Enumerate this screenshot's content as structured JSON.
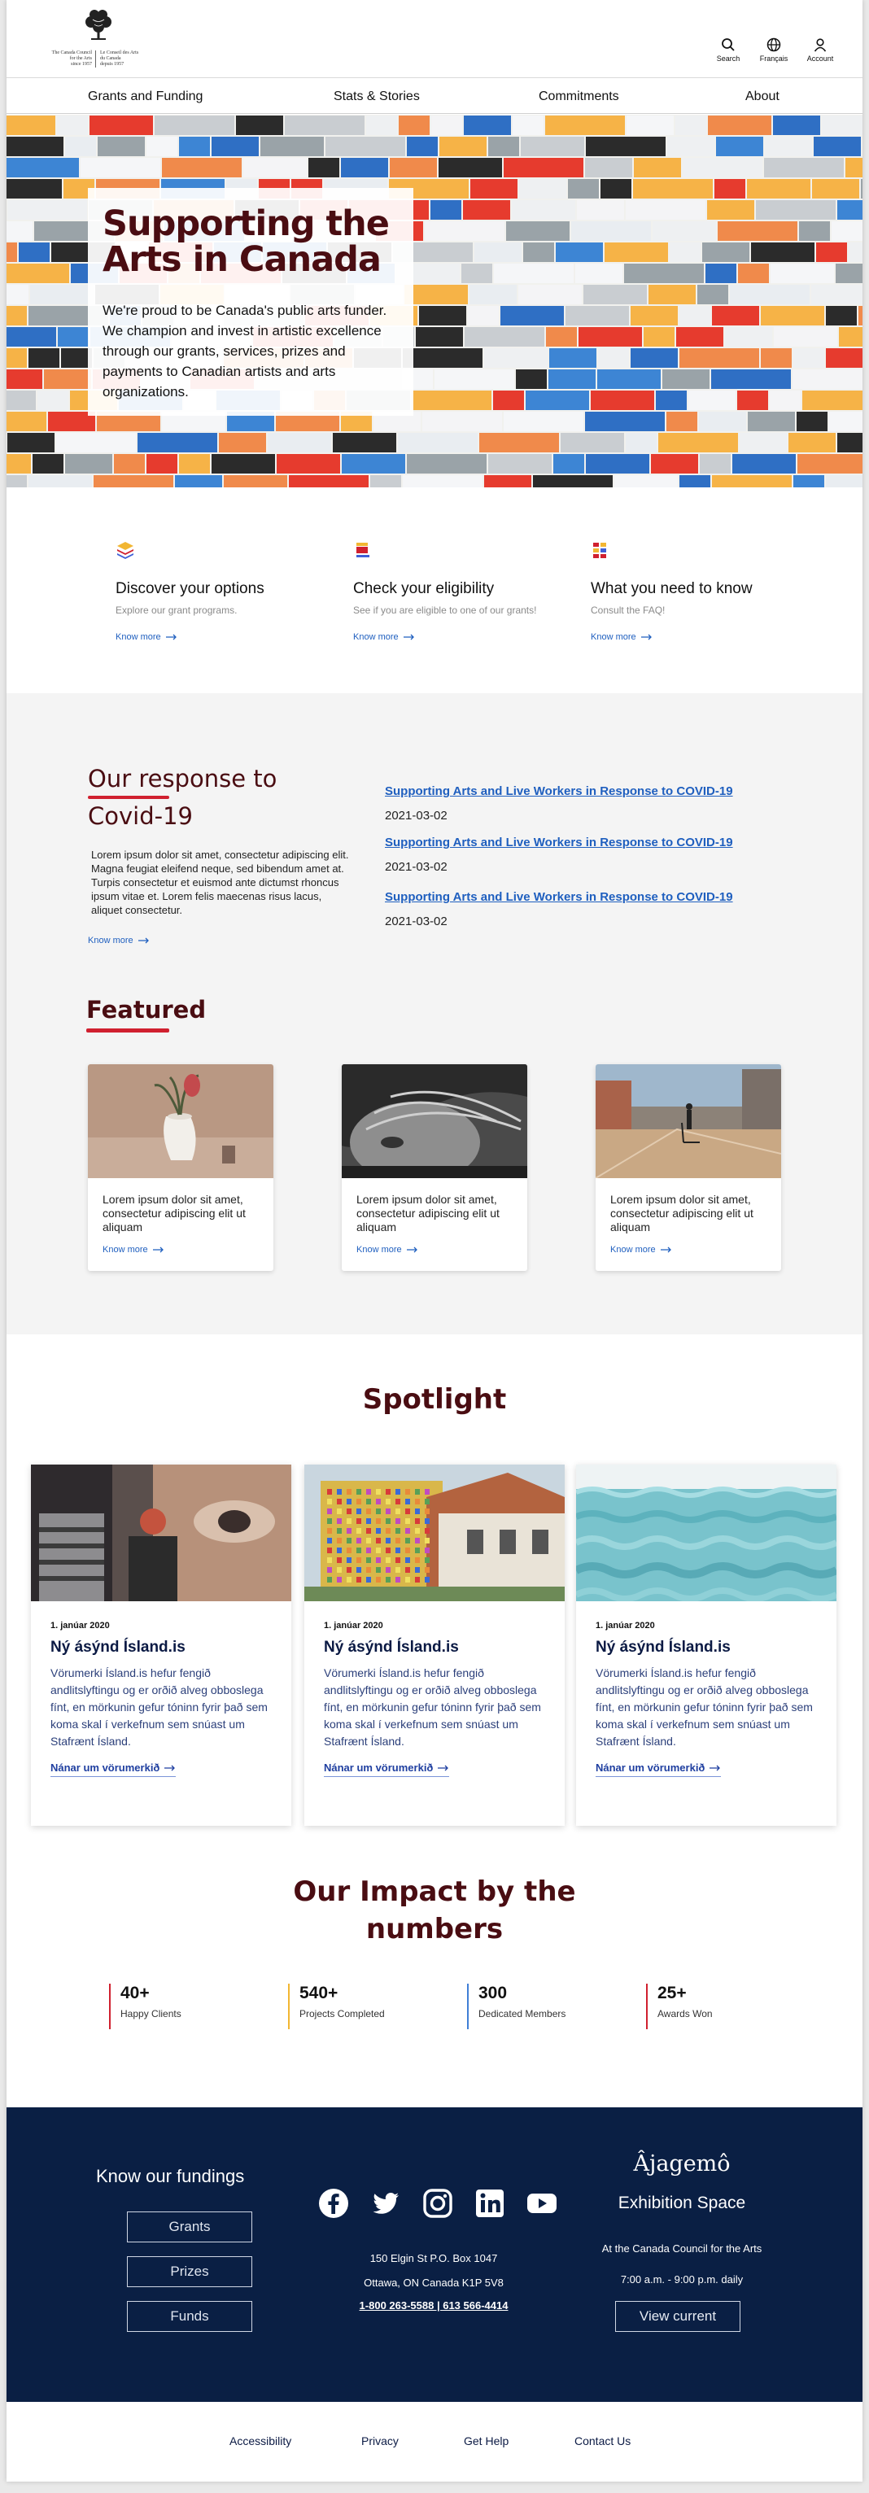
{
  "logo": {
    "en_lines": [
      "The Canada Council",
      "for the Arts",
      "since 1957"
    ],
    "fr_lines": [
      "Le Conseil des Arts",
      "du Canada",
      "depuis 1957"
    ]
  },
  "header_tools": [
    {
      "label": "Search",
      "icon": "search-icon"
    },
    {
      "label": "Français",
      "icon": "globe-icon"
    },
    {
      "label": "Account",
      "icon": "user-icon"
    }
  ],
  "nav": [
    "Grants and Funding",
    "Stats & Stories",
    "Commitments",
    "About"
  ],
  "hero": {
    "title_line1": "Supporting the",
    "title_line2": "Arts in Canada",
    "text": "We're proud to be Canada's public arts funder. We champion and invest in artistic excellence through our grants, services, prizes and payments to Canadian artists and arts organizations."
  },
  "options": [
    {
      "title": "Discover your options",
      "subtitle": "Explore our grant programs.",
      "link": "Know more",
      "icon": "stack-icon"
    },
    {
      "title": "Check your eligibility",
      "subtitle": "See if you are eligible to one of our grants!",
      "link": "Know more",
      "icon": "flag-icon"
    },
    {
      "title": "What you need to know",
      "subtitle": "Consult the FAQ!",
      "link": "Know more",
      "icon": "grid-icon"
    }
  ],
  "response": {
    "title_line1": "Our response to",
    "title_line2": "Covid-19",
    "text": "Lorem ipsum dolor sit amet, consectetur adipiscing elit. Magna feugiat eleifend neque, sed bibendum amet at. Turpis consectetur et euismod ante dictumst rhoncus ipsum vitae et. Lorem felis maecenas risus lacus, aliquet consectetur.",
    "link": "Know more",
    "news": [
      {
        "title": "Supporting Arts and Live Workers in Response to COVID-19",
        "date": "2021-03-02"
      },
      {
        "title": "Supporting Arts and Live Workers in Response to COVID-19",
        "date": "2021-03-02"
      },
      {
        "title": "Supporting Arts and Live Workers in Response to COVID-19",
        "date": "2021-03-02"
      }
    ]
  },
  "featured": {
    "title": "Featured",
    "cards": [
      {
        "text": "Lorem ipsum dolor sit amet, consectetur adipiscing elit ut aliquam",
        "link": "Know more"
      },
      {
        "text": "Lorem ipsum dolor sit amet, consectetur adipiscing elit ut aliquam",
        "link": "Know more"
      },
      {
        "text": "Lorem ipsum dolor sit amet, consectetur adipiscing elit ut aliquam",
        "link": "Know more"
      }
    ]
  },
  "spotlight": {
    "title": "Spotlight",
    "cards": [
      {
        "date": "1. janúar 2020",
        "title": "Ný ásýnd Ísland.is",
        "text": "Vörumerki Ísland.is hefur fengið andlitslyftingu og er orðið alveg obboslega fínt, en mörkunin gefur tóninn fyrir það sem koma skal í verkefnum sem snúast um Stafrænt Ísland.",
        "link": "Nánar um vörumerkið"
      },
      {
        "date": "1. janúar 2020",
        "title": "Ný ásýnd Ísland.is",
        "text": "Vörumerki Ísland.is hefur fengið andlitslyftingu og er orðið alveg obboslega fínt, en mörkunin gefur tóninn fyrir það sem koma skal í verkefnum sem snúast um Stafrænt Ísland.",
        "link": "Nánar um vörumerkið"
      },
      {
        "date": "1. janúar 2020",
        "title": "Ný ásýnd Ísland.is",
        "text": "Vörumerki Ísland.is hefur fengið andlitslyftingu og er orðið alveg obboslega fínt, en mörkunin gefur tóninn fyrir það sem koma skal í verkefnum sem snúast um Stafrænt Ísland.",
        "link": "Nánar um vörumerkið"
      }
    ]
  },
  "impact": {
    "title_line1": "Our Impact by the",
    "title_line2": "numbers",
    "stats": [
      {
        "value": "40+",
        "label": "Happy Clients",
        "color": "#d0202f"
      },
      {
        "value": "540+",
        "label": "Projects Completed",
        "color": "#f2b632"
      },
      {
        "value": "300",
        "label": "Dedicated Members",
        "color": "#3f7fd6"
      },
      {
        "value": "25+",
        "label": "Awards Won",
        "color": "#d0202f"
      }
    ]
  },
  "footer": {
    "fundings_title": "Know our fundings",
    "fundings": [
      "Grants",
      "Prizes",
      "Funds"
    ],
    "socials": [
      "facebook-icon",
      "twitter-icon",
      "instagram-icon",
      "linkedin-icon",
      "youtube-icon"
    ],
    "address_line1": "150 Elgin St P.O. Box 1047",
    "address_line2": "Ottawa, ON Canada K1P 5V8",
    "phone": "1-800 263-5588 | 613 566-4414",
    "ajagemo_title": "Âjagemô",
    "ajagemo_sub": "Exhibition Space",
    "ajagemo_line1": "At the Canada Council for the Arts",
    "ajagemo_line2": "7:00 a.m. - 9:00 p.m. daily",
    "ajagemo_button": "View current"
  },
  "bottom_links": [
    "Accessibility",
    "Privacy",
    "Get Help",
    "Contact Us"
  ],
  "colors": {
    "brand": "#4a0d12",
    "accent_red": "#d0202f",
    "link_blue": "#1f5fbf",
    "footer_navy": "#0a1f44"
  }
}
